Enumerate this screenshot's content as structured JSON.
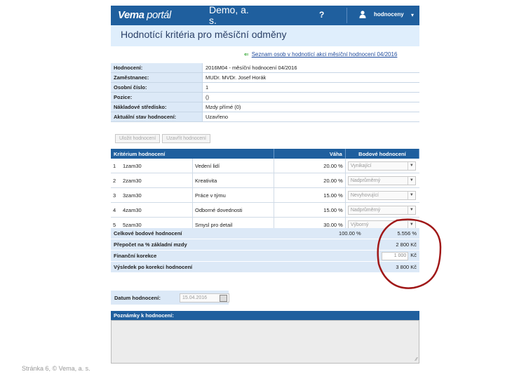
{
  "header": {
    "logo_main": "Vema",
    "logo_sub": " portál",
    "company": "Demo, a. s.",
    "help": "?",
    "user": "hodnoceny",
    "caret": "▾"
  },
  "title": "Hodnotící kritéria pro měsíční odměny",
  "back_link": {
    "arrow": "⇐",
    "text": "Seznam osob v hodnotící akci měsíční hodnocení 04/2016"
  },
  "info": [
    {
      "label": "Hodnocení:",
      "value": "2016M04 - měsíční hodnocení 04/2016"
    },
    {
      "label": "Zaměstnanec:",
      "value": "MUDr. MVDr. Josef Horák"
    },
    {
      "label": "Osobní číslo:",
      "value": "1"
    },
    {
      "label": "Pozice:",
      "value": "()"
    },
    {
      "label": "Nákladové středisko:",
      "value": "Mzdy přímé (0)"
    },
    {
      "label": "Aktuální stav hodnocení:",
      "value": "Uzavřeno"
    }
  ],
  "buttons": {
    "save": "Uložit hodnocení",
    "close": "Uzavřít hodnocení"
  },
  "criteria": {
    "headers": {
      "criterion": "Kritérium hodnocení",
      "weight": "Váha",
      "score": "Bodové hodnocení"
    },
    "rows": [
      {
        "num": "1",
        "code": "1zam30",
        "name": "Vedení lidí",
        "weight": "20.00 %",
        "score": "Vynikající"
      },
      {
        "num": "2",
        "code": "2zam30",
        "name": "Kreativita",
        "weight": "20.00 %",
        "score": "Nadprůměrný"
      },
      {
        "num": "3",
        "code": "3zam30",
        "name": "Práce v týmu",
        "weight": "15.00 %",
        "score": "Nevyhovující"
      },
      {
        "num": "4",
        "code": "4zam30",
        "name": "Odborné dovednosti",
        "weight": "15.00 %",
        "score": "Nadprůměrný"
      },
      {
        "num": "5",
        "code": "5zam30",
        "name": "Smysl pro detail",
        "weight": "30.00 %",
        "score": "Výborný"
      }
    ]
  },
  "summary": {
    "total_label": "Celkové bodové hodnocení",
    "total_weight": "100.00 %",
    "total_value": "5.556 %",
    "recalc_label": "Přepočet na % základní mzdy",
    "recalc_value": "2 800 Kč",
    "fin_label": "Finanční korekce",
    "fin_input": "1 000",
    "fin_unit": "Kč",
    "result_label": "Výsledek po korekci hodnocení",
    "result_value": "3 800 Kč"
  },
  "date": {
    "label": "Datum hodnocení:",
    "value": "15.04.2016"
  },
  "notes": {
    "label": "Poznámky k hodnocení:",
    "grip": "⁄⁄"
  },
  "footer": "Stránka 6, © Vema, a. s.",
  "colors": {
    "header_blue": "#1f5f9e",
    "light_blue": "#dce9f7",
    "annotation_red": "#a01818"
  }
}
